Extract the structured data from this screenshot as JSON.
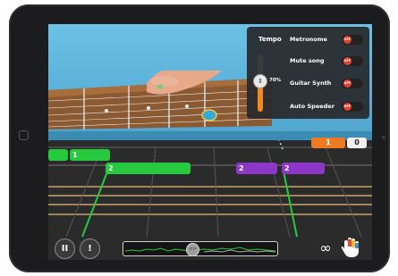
{
  "settings_panel": {
    "tempo_label": "Tempo",
    "tempo_value": "70%",
    "tempo_level_percent": 70,
    "options": [
      {
        "label": "Metronome",
        "state": "OFF"
      },
      {
        "label": "Mute song",
        "state": "OFF"
      },
      {
        "label": "Guitar Synth",
        "state": "OFF"
      },
      {
        "label": "Auto Speeder",
        "state": "OFF"
      }
    ]
  },
  "notes": {
    "note_a": "1",
    "note_b": "2",
    "note_c": "2",
    "note_d": "2"
  },
  "counters": {
    "combo": "1",
    "score": "0"
  },
  "controls": {
    "pause_glyph": "II",
    "tips_glyph": "!",
    "loop_glyph": "∞",
    "scrub_glyph": "<>"
  },
  "icons": [
    "pause-icon",
    "footsteps-icon",
    "scrub-icon",
    "loop-icon",
    "hand-icon"
  ],
  "colors": {
    "green": "#27c93f",
    "purple": "#8d37c8",
    "orange": "#f07a22",
    "panel": "#28282a",
    "toggle_off": "#e4422a"
  }
}
